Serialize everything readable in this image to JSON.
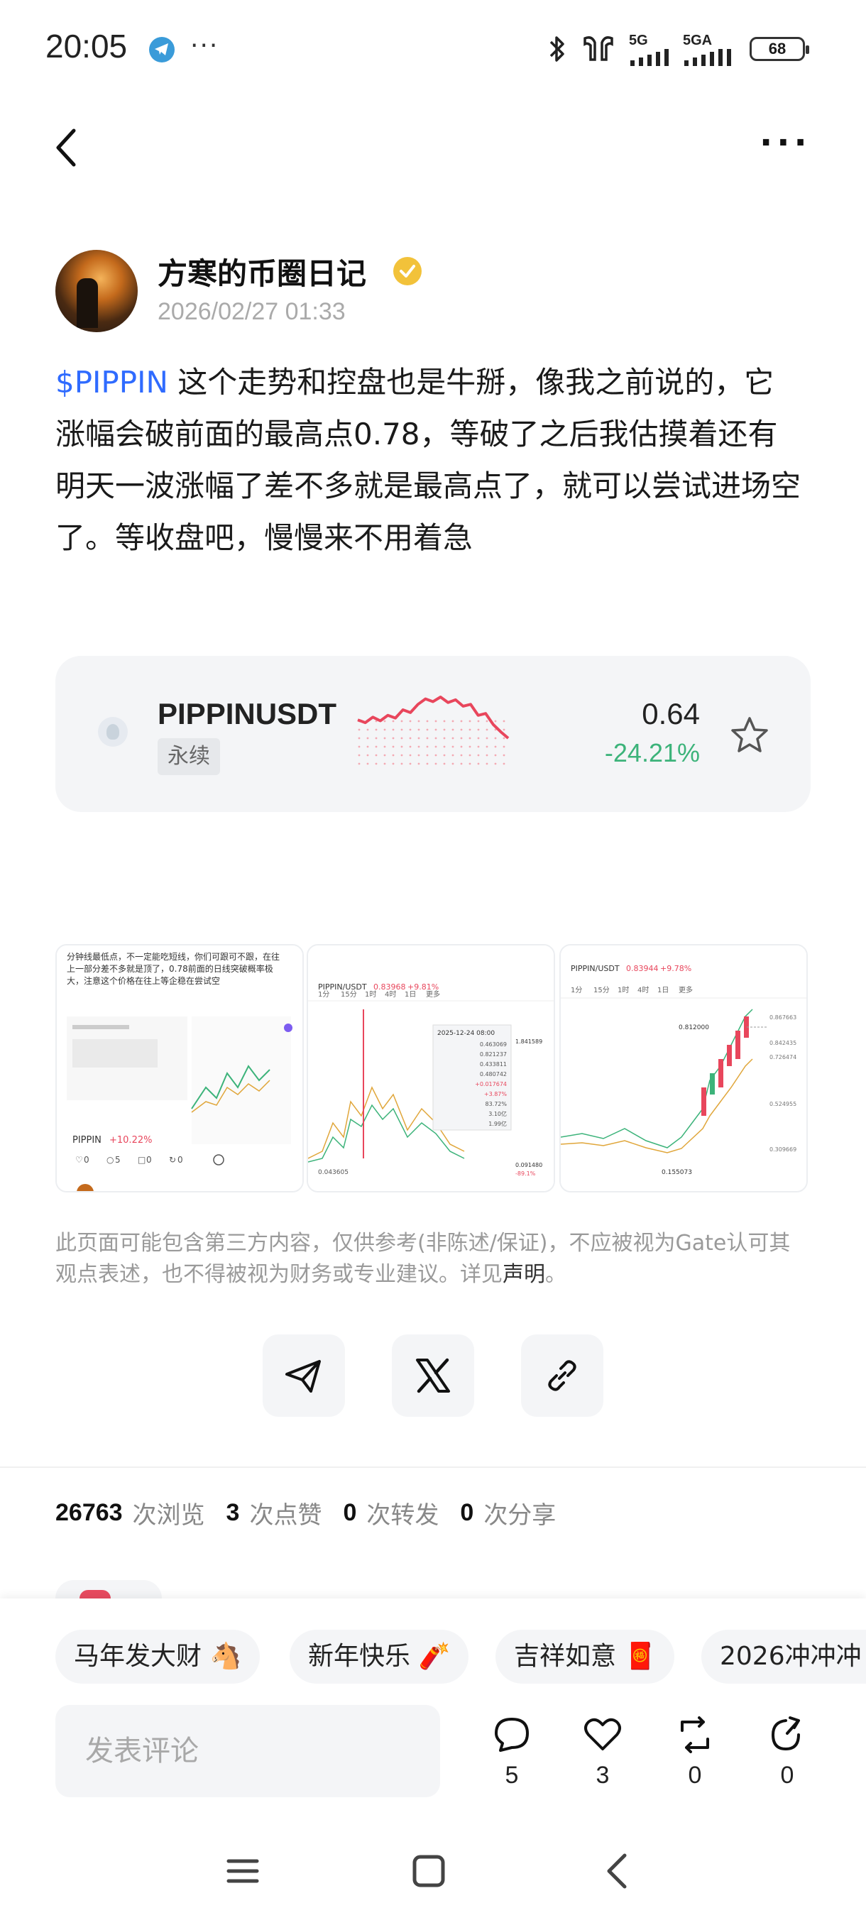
{
  "status_bar": {
    "time": "20:05",
    "more": "···",
    "net1": "5G",
    "net2": "5GA",
    "battery": "68",
    "icons": [
      "telegram-icon",
      "bluetooth-icon",
      "earbuds-icon",
      "signal-icon",
      "battery-icon"
    ]
  },
  "nav": {
    "back_icon": "chevron-left-icon",
    "more_icon": "more-dots-icon",
    "more_label": "···"
  },
  "author": {
    "name": "方寒的币圈日记",
    "verified_icon": "verified-badge-icon",
    "timestamp": "2026/02/27 01:33"
  },
  "post": {
    "ticker": "$PIPPIN",
    "text": " 这个走势和控盘也是牛掰，像我之前说的，它涨幅会破前面的最高点0.78，等破了之后我估摸着还有明天一波涨幅了差不多就是最高点了，就可以尝试进场空了。等收盘吧，慢慢来不用着急"
  },
  "ticker_card": {
    "pair": "PIPPINUSDT",
    "tag": "永续",
    "price": "0.64",
    "change": "-24.21%",
    "change_color": "#3cb37a",
    "sparkline_color": "#e8465c",
    "sparkline": [
      0.55,
      0.52,
      0.58,
      0.54,
      0.6,
      0.57,
      0.66,
      0.63,
      0.72,
      0.78,
      0.75,
      0.8,
      0.74,
      0.77,
      0.7,
      0.72,
      0.6,
      0.62,
      0.5,
      0.42,
      0.35
    ]
  },
  "images": {
    "thumb1": {
      "caption": "分钟线最低点，不一定能吃短线，你们可跟可不跟，在往上一部分差不多就是顶了，0.78前面的日线突破概率极大，注意这个价格在往上等企稳在尝试空",
      "tag": "PIPPIN",
      "tag_change": "+10.22%",
      "counts": [
        "0",
        "5",
        "0",
        "0"
      ]
    },
    "thumb2": {
      "pair": "PIPPIN/USDT",
      "price": "0.83968",
      "change": "+9.81%",
      "tabs": [
        "1分",
        "15分",
        "1时",
        "4时",
        "1日",
        "更多"
      ],
      "popup_date": "2025-12-24 08:00",
      "popup_rows": [
        "0.463069",
        "0.821237",
        "0.433811",
        "0.480742",
        "+0.017674",
        "+3.87%",
        "83.72%",
        "3.10亿",
        "1.99亿"
      ],
      "low_label": "0.043605",
      "price_tag": "1.841589",
      "tail_price": "0.091480",
      "tail_change": "-89.1%"
    },
    "thumb3": {
      "pair": "PIPPIN/USDT",
      "price": "0.83944",
      "change": "+9.78%",
      "tabs": [
        "1分",
        "15分",
        "1时",
        "4时",
        "1日",
        "更多"
      ],
      "high_label": "0.812000",
      "low_label": "0.155073",
      "axis": [
        "0.867663",
        "0.842435",
        "0.726474",
        "0.524955",
        "0.309669"
      ]
    }
  },
  "disclaimer": {
    "text": "此页面可能包含第三方内容，仅供参考(非陈述/保证)，不应被视为Gate认可其观点表述，也不得被视为财务或专业建议。详见",
    "link": "声明",
    "end": "。"
  },
  "share": {
    "icons": [
      "telegram-share-icon",
      "x-logo-icon",
      "copy-link-icon"
    ]
  },
  "stats": {
    "views": "26763",
    "views_label": "次浏览",
    "likes": "3",
    "likes_label": "次点赞",
    "reposts": "0",
    "reposts_label": "次转发",
    "shares": "0",
    "shares_label": "次分享"
  },
  "quick_replies": [
    {
      "label": "马年发大财",
      "emoji": "🐴"
    },
    {
      "label": "新年快乐",
      "emoji": "🧨"
    },
    {
      "label": "吉祥如意",
      "emoji": "🧧"
    },
    {
      "label": "2026冲冲冲",
      "emoji": ""
    }
  ],
  "comment": {
    "placeholder": "发表评论"
  },
  "actions": {
    "comments": "5",
    "likes": "3",
    "reposts": "0",
    "shares": "0"
  },
  "system_nav": {
    "icons": [
      "menu-icon",
      "home-square-icon",
      "back-triangle-icon"
    ]
  }
}
